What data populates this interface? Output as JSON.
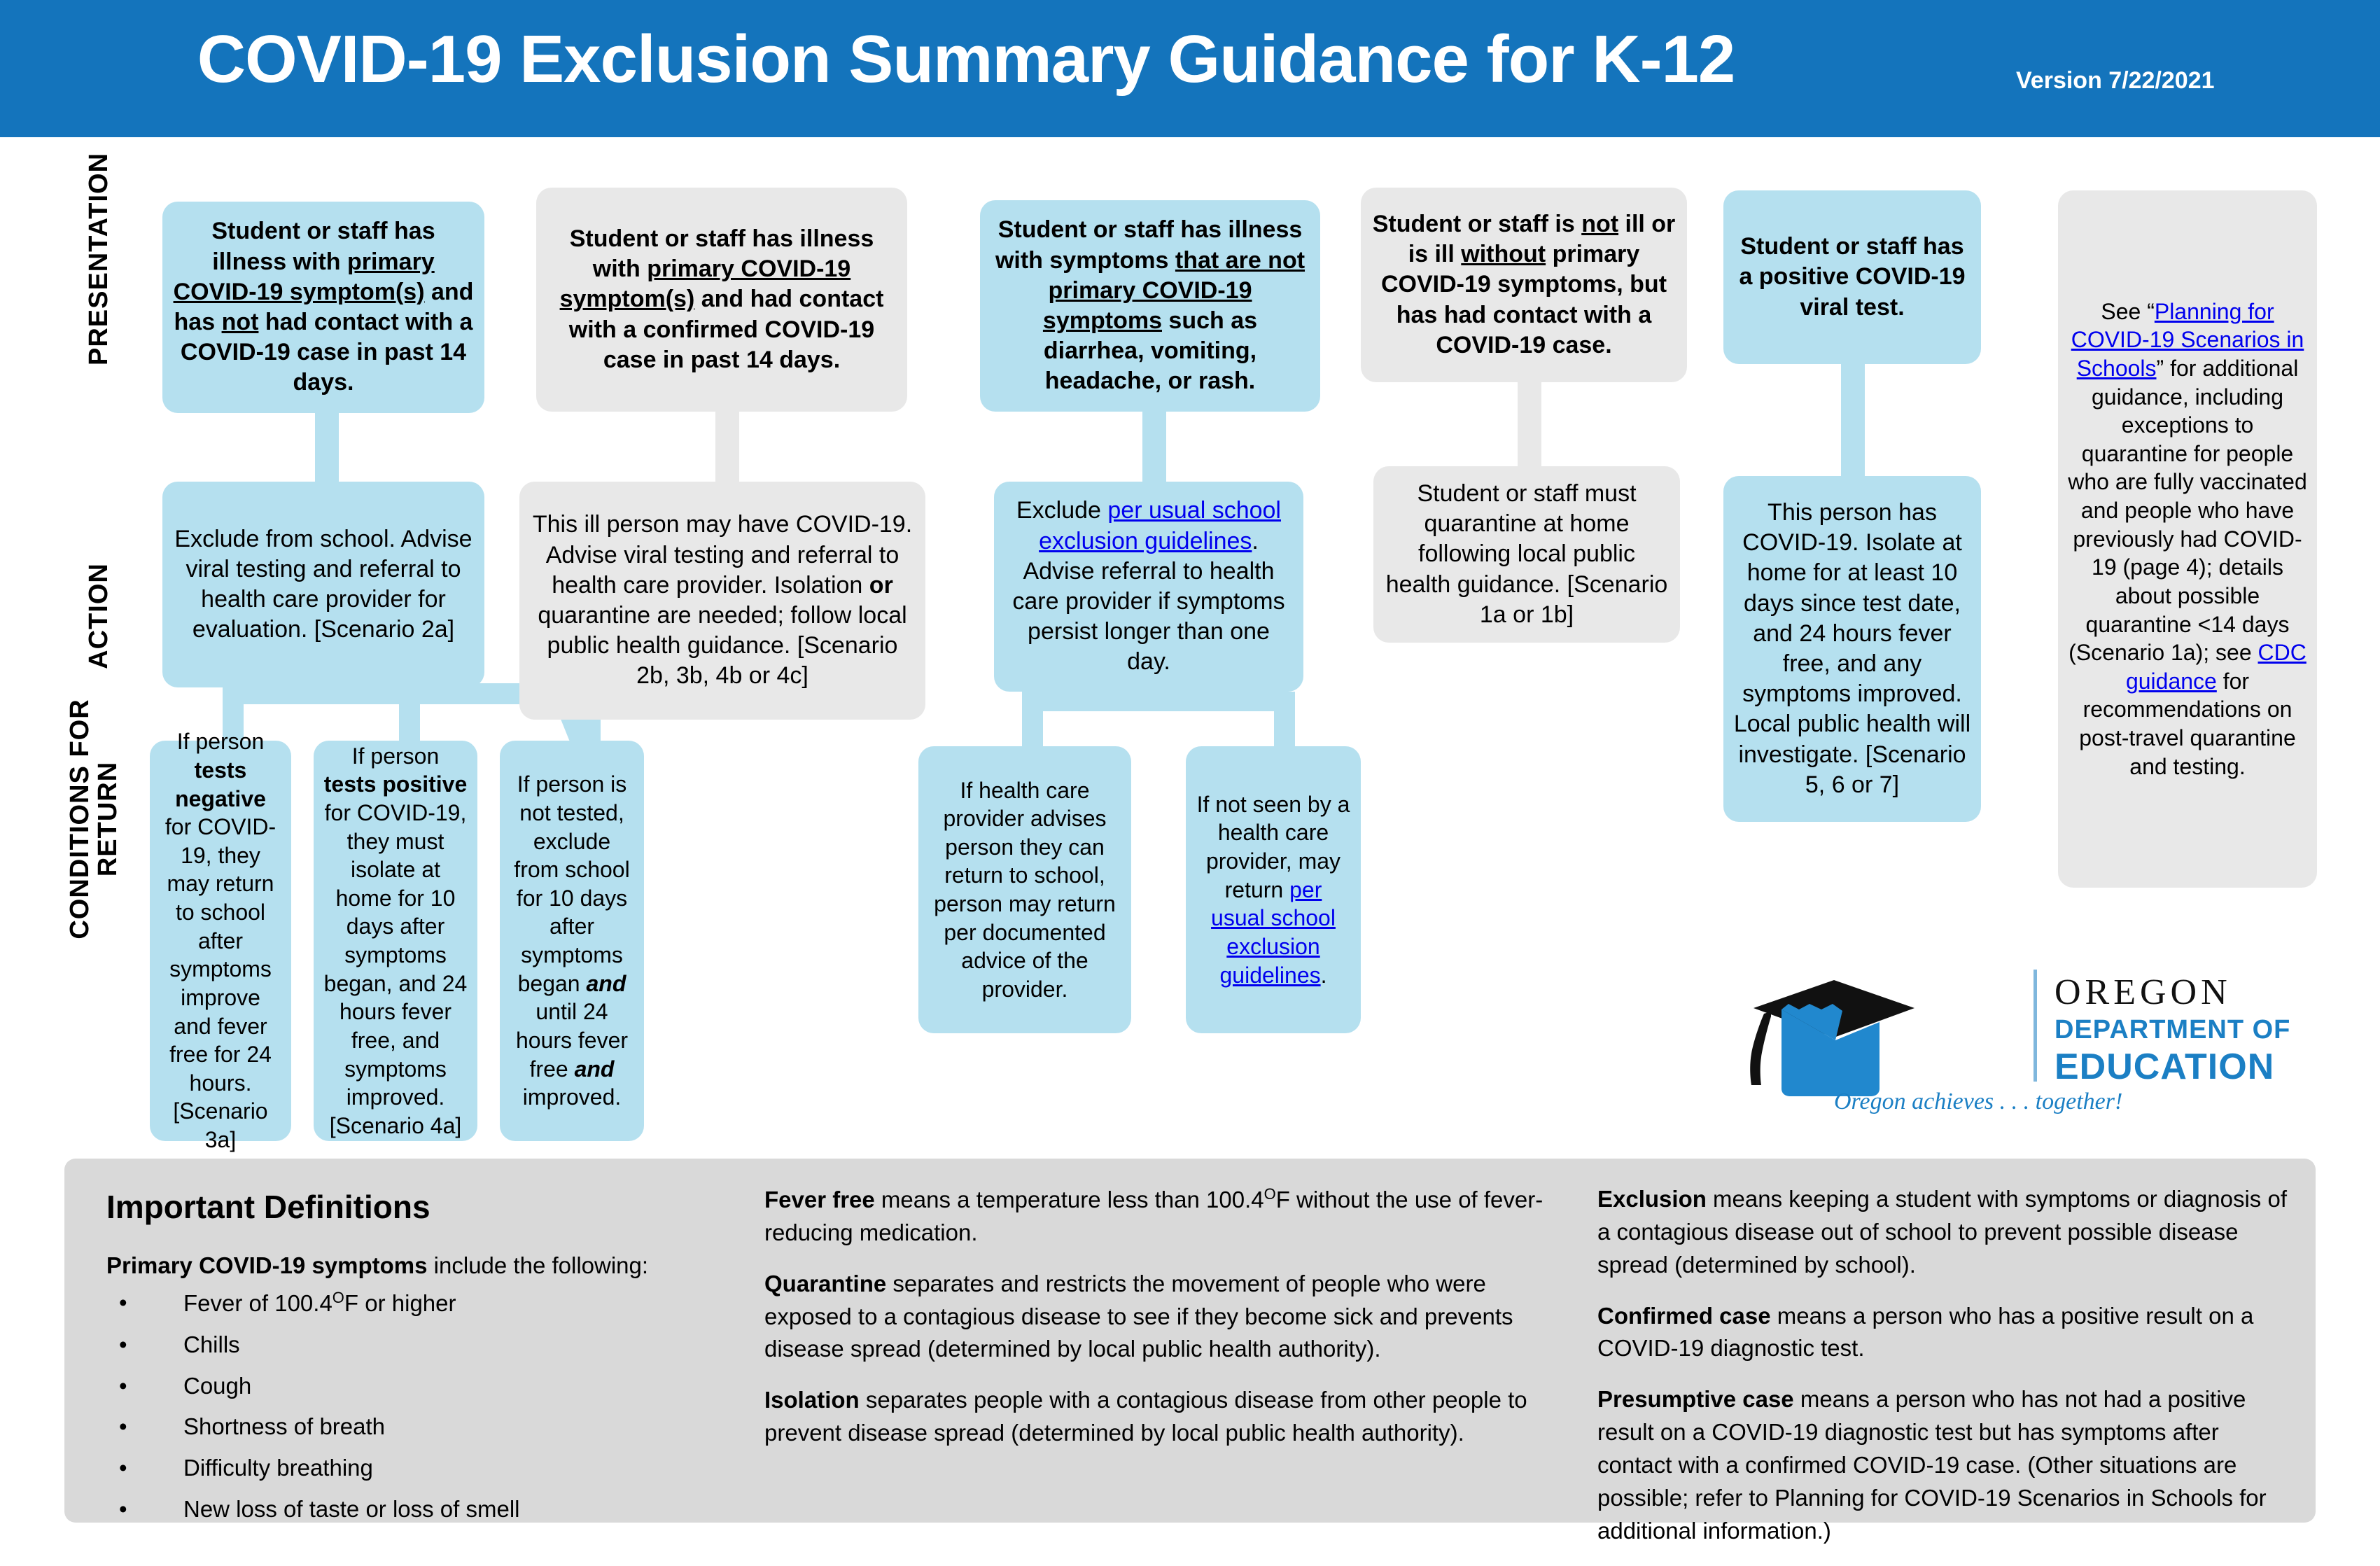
{
  "header": {
    "title": "COVID-19 Exclusion Summary Guidance for K-12",
    "version": "Version 7/22/2021",
    "bg_color": "#1474bc"
  },
  "colors": {
    "blue_box": "#b5e0ef",
    "gray_box": "#e8e8e8",
    "panel_gray": "#d9d9d9",
    "link": "#0000ee",
    "header_blue": "#1474bc",
    "logo_blue": "#1b7fc4"
  },
  "row_labels": {
    "presentation": "PRESENTATION",
    "action": "ACTION",
    "conditions": "CONDITIONS FOR RETURN"
  },
  "columns": [
    {
      "id": "col1",
      "style": "blue",
      "presentation": "Student or staff has illness with <u>primary COVID-19 symptom(s)</u> and has <u>not</u> had contact with a COVID-19 case in past 14 days.",
      "action": "Exclude from school. Advise viral testing and referral to health care provider for evaluation. [Scenario 2a]",
      "returns": [
        "If person <b>tests negative</b> for COVID-19, they may return to school after symptoms improve and fever free for 24 hours. [Scenario 3a]",
        "If person <b>tests positive</b> for COVID-19, they must isolate at home for 10 days after symptoms began, and 24 hours fever free, and symptoms improved. [Scenario 4a]",
        "If person is not tested, exclude from school for 10 days after symptoms began <i>and</i> until 24 hours fever free <i>and</i> improved."
      ]
    },
    {
      "id": "col2",
      "style": "gray",
      "presentation": "Student or staff has illness with <u>primary COVID-19 symptom(s)</u> and had contact with a confirmed COVID-19 case in past 14 days.",
      "action": "This ill person may have COVID-19. Advise viral testing and referral to health care provider. Isolation <b>or</b> quarantine are needed; follow local public health guidance. [Scenario 2b, 3b, 4b or 4c]",
      "returns": []
    },
    {
      "id": "col3",
      "style": "blue",
      "presentation": "Student or staff has illness with symptoms <u>that are not primary COVID-19 symptoms</u> such as diarrhea, vomiting, headache, or rash.",
      "action": "Exclude <a>per usual school exclusion guidelines</a>. Advise referral to health care provider if symptoms persist longer than one day.",
      "returns": [
        "If health care provider advises person they can return to school, person may return per documented advice of the provider.",
        "If not seen by a health care provider, may return <a>per usual school exclusion guidelines</a>."
      ]
    },
    {
      "id": "col4",
      "style": "gray",
      "presentation": "Student or staff is <u>not</u> ill or is ill <u>without</u> primary COVID-19 symptoms, but has had contact with a COVID-19 case.",
      "action": "Student or staff must quarantine at home following local public health guidance. [Scenario 1a or 1b]",
      "returns": []
    },
    {
      "id": "col5",
      "style": "blue",
      "presentation": "Student or staff has a positive COVID-19 viral test.",
      "action": "This person has COVID-19. Isolate at home for at least 10 days since test date, and 24 hours fever free, and any symptoms improved. Local public health will investigate. [Scenario 5, 6 or 7]",
      "returns": []
    }
  ],
  "sidebar_note": "See “<a>Planning for COVID-19 Scenarios in Schools</a>” for additional guidance, including exceptions to quarantine for people who are fully vaccinated and people who have previously had COVID-19 (page 4); details about possible quarantine <14 days (Scenario 1a); see <a>CDC guidance</a> for recommendations on post-travel quarantine and testing.",
  "definitions": {
    "title": "Important Definitions",
    "col1": {
      "lead": "<b>Primary COVID-19 symptoms</b> include the following:",
      "bullet_glyph": "•",
      "items": [
        "Fever of 100.4<sup>O</sup>F or higher",
        "Chills",
        "Cough",
        "Shortness of breath",
        "Difficulty breathing",
        "New loss of taste or loss of smell"
      ]
    },
    "col2": [
      "<b>Fever free</b> means a temperature less than 100.4<sup>O</sup>F without the use of fever-reducing medication.",
      "<b>Quarantine</b> separates and restricts the movement of people who were exposed to a contagious disease to see if they become sick and prevents disease spread (determined by local public health authority).",
      "<b>Isolation</b> separates people with a contagious disease from other people to prevent disease spread (determined by local public health authority)."
    ],
    "col3": [
      "<b>Exclusion</b> means keeping a student with symptoms or diagnosis of a contagious disease out of school to prevent possible disease spread (determined by school).",
      "<b>Confirmed case</b> means a person who has a positive result on a COVID-19 diagnostic test.",
      "<b>Presumptive case</b> means a person who has not had a positive result on a COVID-19 diagnostic test but has symptoms after contact with a confirmed COVID-19 case. (Other situations are possible; refer to Planning for COVID-19 Scenarios in Schools for additional information.)"
    ]
  },
  "logo": {
    "org": "OREGON",
    "department": "DEPARTMENT OF",
    "education": "EDUCATION",
    "tagline": "Oregon achieves . . . together!"
  }
}
